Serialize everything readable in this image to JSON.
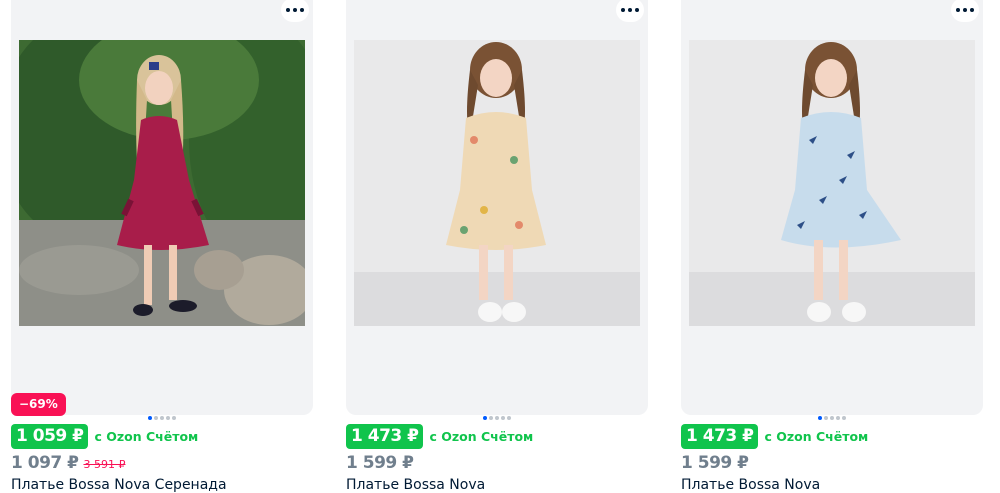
{
  "products": [
    {
      "discount": "−69%",
      "price": "1 059 ₽",
      "price_note": "c Ozon Счётом",
      "old_price": "1 097 ₽",
      "crossed_price": "3 591 ₽",
      "title": "Платье Bossa Nova Серенада"
    },
    {
      "price": "1 473 ₽",
      "price_note": "c Ozon Счётом",
      "old_price": "1 599 ₽",
      "title": "Платье Bossa Nova"
    },
    {
      "price": "1 473 ₽",
      "price_note": "c Ozon Счётом",
      "old_price": "1 599 ₽",
      "title": "Платье Bossa Nova"
    }
  ],
  "colors": {
    "price_green": "#10c44c",
    "badge_pink": "#f91155",
    "dot_active": "#005bff"
  },
  "icons": [
    "more-icon"
  ]
}
